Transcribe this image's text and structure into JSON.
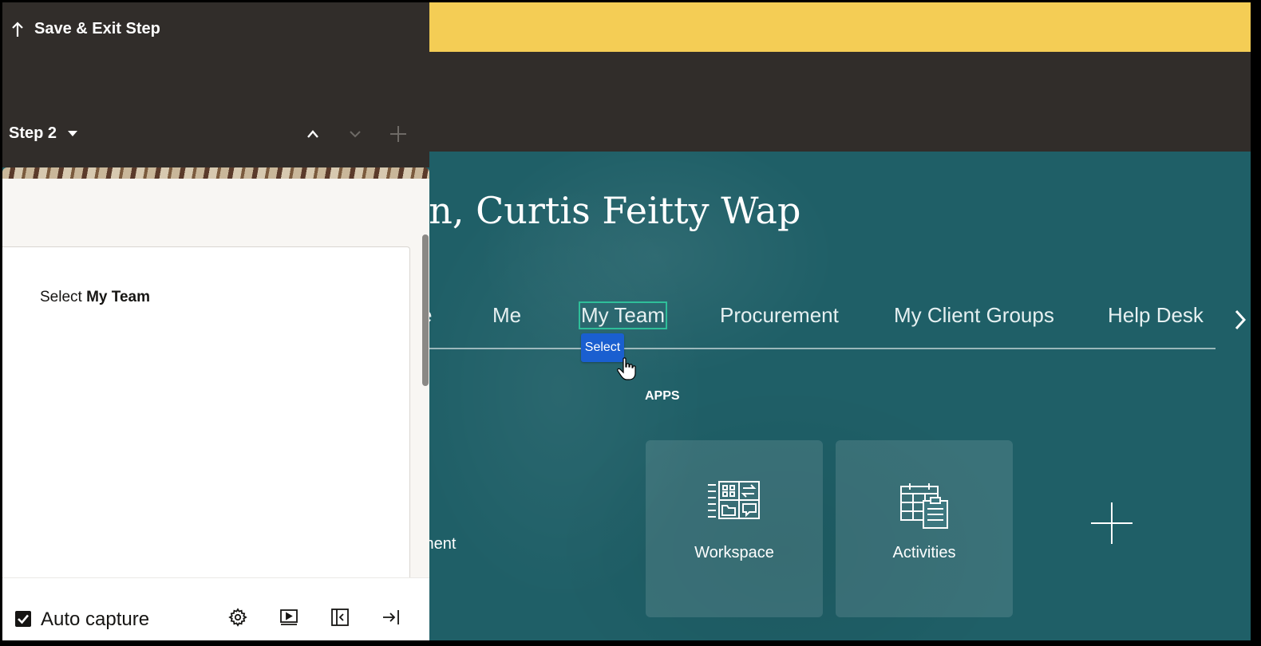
{
  "app": {
    "greeting": "ernoon, Curtis Feitty Wap",
    "nav_tabs": [
      {
        "label": "e"
      },
      {
        "label": "Me"
      },
      {
        "label": "My Team"
      },
      {
        "label": "Procurement"
      },
      {
        "label": "My Client Groups"
      },
      {
        "label": "Help Desk"
      }
    ],
    "select_tooltip": "Select",
    "apps_heading": "APPS",
    "partial_app_label": "ment",
    "apps": [
      {
        "label": "Workspace",
        "icon": "workspace-icon"
      },
      {
        "label": "Activities",
        "icon": "activities-icon"
      }
    ]
  },
  "recorder": {
    "save_exit_label": "Save & Exit Step",
    "step_label": "Step 2",
    "instruction_prefix": "Select",
    "instruction_target": "My Team",
    "auto_capture_label": "Auto capture",
    "auto_capture_checked": true
  },
  "colors": {
    "yellow_banner": "#f4cd55",
    "dark_header": "#312d2a",
    "teal_background": "#1f5f67",
    "select_tooltip": "#1a5fd0",
    "highlight_outline": "#2fbf9a"
  }
}
